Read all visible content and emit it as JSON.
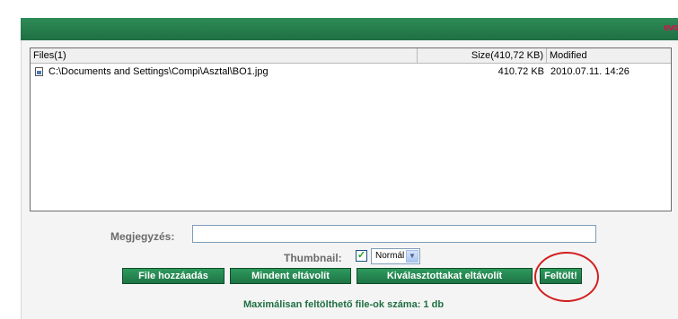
{
  "header": {
    "logo_text": "evo"
  },
  "file_list": {
    "columns": {
      "name": "Files(1)",
      "size": "Size(410,72 KB)",
      "modified": "Modified"
    },
    "rows": [
      {
        "name": "C:\\Documents and Settings\\Compi\\Asztal\\BO1.jpg",
        "size": "410.72 KB",
        "modified": "2010.07.11. 14:26",
        "icon": "image-file-icon"
      }
    ]
  },
  "form": {
    "comment_label": "Megjegyzés:",
    "comment_value": "",
    "thumbnail_label": "Thumbnail:",
    "thumbnail_checked": "✓",
    "thumbnail_select": "Normál"
  },
  "buttons": {
    "add": "File hozzáadás",
    "clear_all": "Mindent eltávolít",
    "remove_selected": "Kiválasztottakat eltávolít",
    "upload": "Feltölt!"
  },
  "footer": {
    "text": "Maximálisan feltölthető file-ok száma: 1 db"
  },
  "colors": {
    "accent": "#1f6f43",
    "highlight_circle": "#d21f1f"
  }
}
